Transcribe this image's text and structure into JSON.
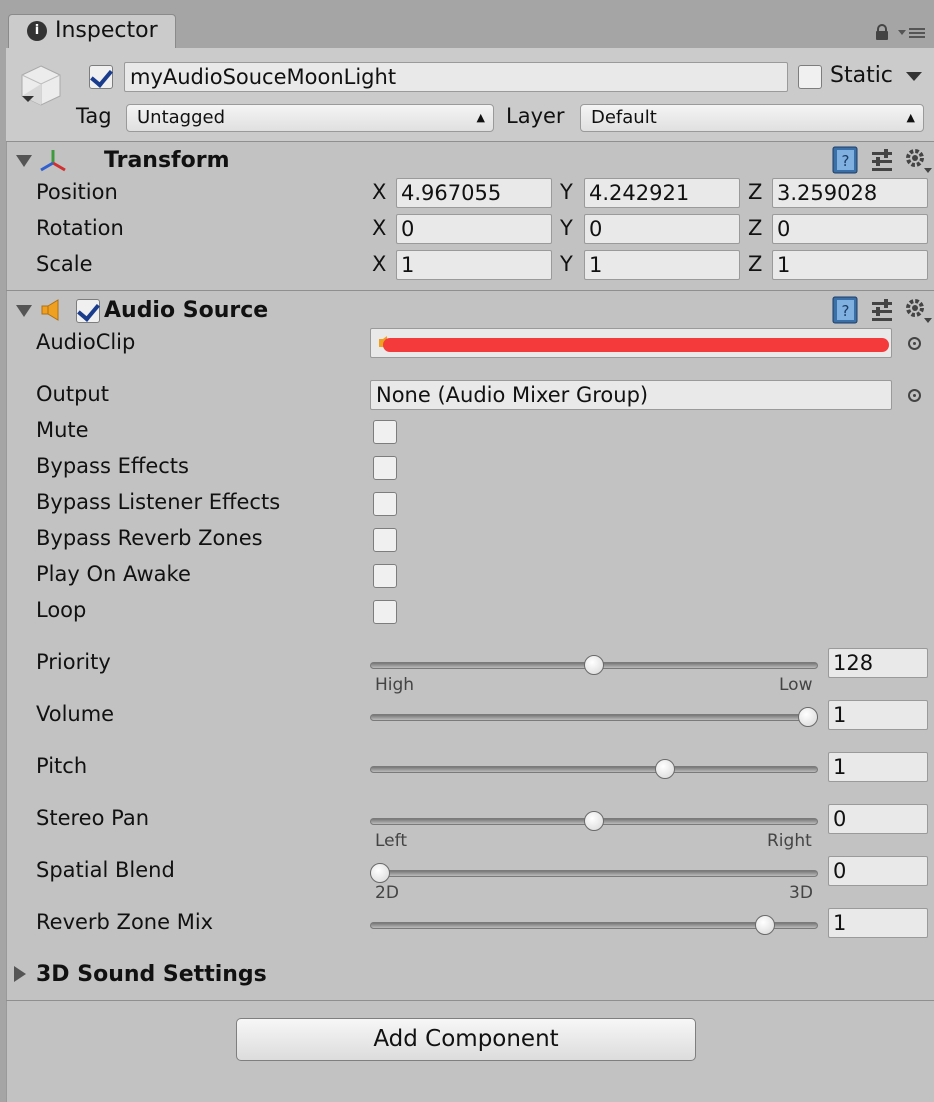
{
  "tab": {
    "label": "Inspector"
  },
  "game_object": {
    "active": true,
    "name": "myAudioSouceMoonLight",
    "static_label": "Static",
    "static": false,
    "tag_label": "Tag",
    "tag_value": "Untagged",
    "layer_label": "Layer",
    "layer_value": "Default"
  },
  "transform": {
    "title": "Transform",
    "rows": [
      {
        "label": "Position",
        "x": "4.967055",
        "y": "4.242921",
        "z": "3.259028"
      },
      {
        "label": "Rotation",
        "x": "0",
        "y": "0",
        "z": "0"
      },
      {
        "label": "Scale",
        "x": "1",
        "y": "1",
        "z": "1"
      }
    ],
    "axes": {
      "x": "X",
      "y": "Y",
      "z": "Z"
    }
  },
  "audio_source": {
    "title": "Audio Source",
    "enabled": true,
    "audio_clip_label": "AudioClip",
    "output_label": "Output",
    "output_value": "None (Audio Mixer Group)",
    "toggles": [
      {
        "label": "Mute",
        "checked": false
      },
      {
        "label": "Bypass Effects",
        "checked": false
      },
      {
        "label": "Bypass Listener Effects",
        "checked": false
      },
      {
        "label": "Bypass Reverb Zones",
        "checked": false
      },
      {
        "label": "Play On Awake",
        "checked": false
      },
      {
        "label": "Loop",
        "checked": false
      }
    ],
    "sliders": [
      {
        "label": "Priority",
        "value": "128",
        "fraction": 0.5,
        "min_hint": "High",
        "max_hint": "Low"
      },
      {
        "label": "Volume",
        "value": "1",
        "fraction": 1.0
      },
      {
        "label": "Pitch",
        "value": "1",
        "fraction": 0.665
      },
      {
        "label": "Stereo Pan",
        "value": "0",
        "fraction": 0.5,
        "min_hint": "Left",
        "max_hint": "Right"
      },
      {
        "label": "Spatial Blend",
        "value": "0",
        "fraction": 0.0,
        "min_hint": "2D",
        "max_hint": "3D"
      },
      {
        "label": "Reverb Zone Mix",
        "value": "1",
        "fraction": 0.9
      }
    ],
    "sound_settings_label": "3D Sound Settings"
  },
  "add_component": {
    "label": "Add Component"
  },
  "colors": {
    "redaction": "#f43a3a",
    "speaker": "#f0a020",
    "check": "#1a3c8c"
  }
}
